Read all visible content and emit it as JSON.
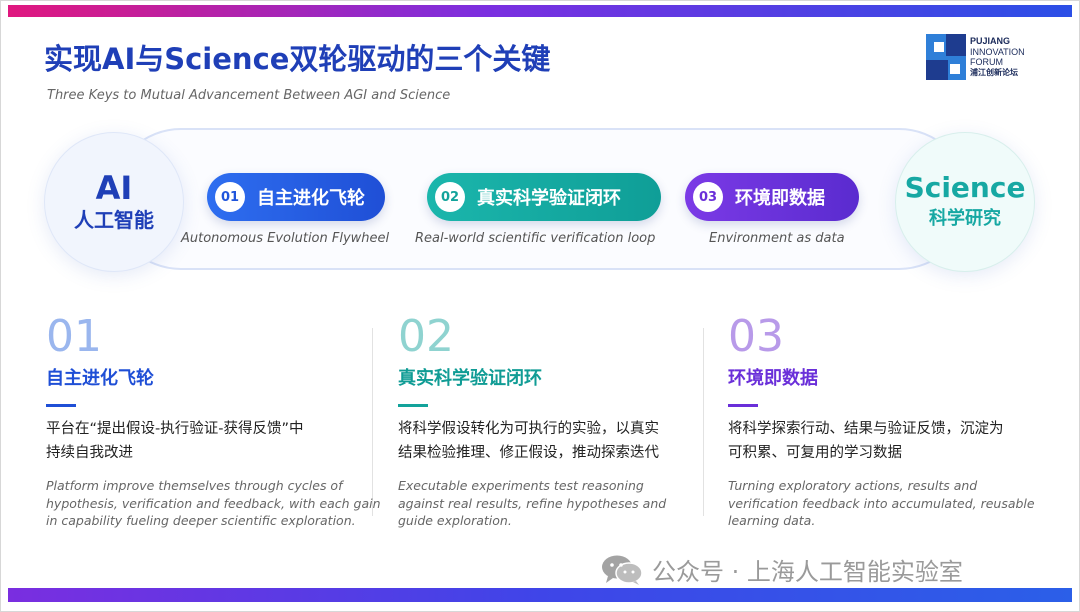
{
  "header": {
    "title": "实现AI与Science双轮驱动的三个关键",
    "subtitle": "Three Keys to Mutual Advancement Between AGI and Science"
  },
  "logo": {
    "line1": "PUJIANG",
    "line2": "INNOVATION",
    "line3": "FORUM",
    "line4": "浦江创新论坛"
  },
  "band": {
    "ai": {
      "big": "AI",
      "small": "人工智能"
    },
    "science": {
      "big": "Science",
      "small": "科学研究"
    },
    "keys": [
      {
        "num": "01",
        "label": "自主进化飞轮",
        "en": "Autonomous Evolution Flywheel"
      },
      {
        "num": "02",
        "label": "真实科学验证闭环",
        "en": "Real-world scientific verification loop"
      },
      {
        "num": "03",
        "label": "环境即数据",
        "en": "Environment as data"
      }
    ]
  },
  "columns": [
    {
      "num": "01",
      "title": "自主进化飞轮",
      "cn": [
        "平台在“提出假设-执行验证-获得反馈”中",
        "持续自我改进"
      ],
      "en": [
        "Platform improve themselves through cycles of",
        "hypothesis, verification and feedback, with each gain",
        "in capability fueling deeper scientific exploration."
      ]
    },
    {
      "num": "02",
      "title": "真实科学验证闭环",
      "cn": [
        "将科学假设转化为可执行的实验，以真实",
        "结果检验推理、修正假设，推动探索迭代"
      ],
      "en": [
        "Executable experiments test reasoning",
        "against real results, refine hypotheses and",
        "guide exploration."
      ]
    },
    {
      "num": "03",
      "title": "环境即数据",
      "cn": [
        "将科学探索行动、结果与验证反馈，沉淀为",
        "可积累、可复用的学习数据"
      ],
      "en": [
        "Turning exploratory actions, results and",
        "verification feedback into accumulated, reusable",
        "learning data."
      ]
    }
  ],
  "watermark": {
    "text": "公众号 · 上海人工智能实验室",
    "icon": "wechat-icon"
  },
  "colors": {
    "blue": "#1f4fd6",
    "teal": "#13a39b",
    "purple": "#6a2fd9",
    "title": "#1f3fb7"
  }
}
